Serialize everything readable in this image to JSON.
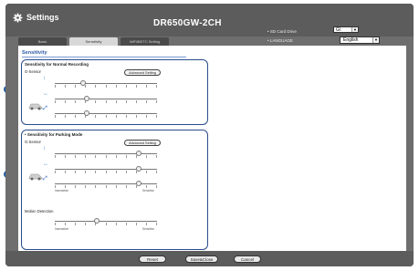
{
  "header": {
    "title": "Settings",
    "device": "DR650GW-2CH",
    "sd_label": "• SD Card Drive",
    "sd_value": "G\\",
    "lang_label": "• LANGUAGE",
    "lang_value": "English"
  },
  "tabs": [
    {
      "label": "Basic"
    },
    {
      "label": "Sensitivity"
    },
    {
      "label": "WiFi/BETC Setting"
    }
  ],
  "main": {
    "section_title": "Sensitivity",
    "normal": {
      "title": "Sensitivity for Normal Recording",
      "gsensor": "G-Sensor",
      "advanced": "Advanced Setting",
      "axes": [
        "↕",
        "↔",
        "⤢"
      ],
      "levels": [
        0.28,
        0.31,
        0.31
      ]
    },
    "parking": {
      "title": "• Sensitivity for Parking Mode",
      "gsensor": "G-Sensor",
      "advanced": "Advanced Setting",
      "axes": [
        "↕",
        "↔",
        "⤢"
      ],
      "levels": [
        0.82,
        0.82,
        0.82
      ],
      "insensitive": "Insensitive",
      "sensitive": "Sensitive",
      "motion": "Motion Detection",
      "motion_level": 0.41,
      "motion_insensitive": "Insensitive",
      "motion_sensitive": "Sensitive"
    }
  },
  "footer": {
    "reset": "Reset",
    "save_close": "Save&Close",
    "cancel": "Cancel"
  },
  "colors": {
    "accent": "#2b4c8c",
    "callout": "#1f5fa8"
  }
}
